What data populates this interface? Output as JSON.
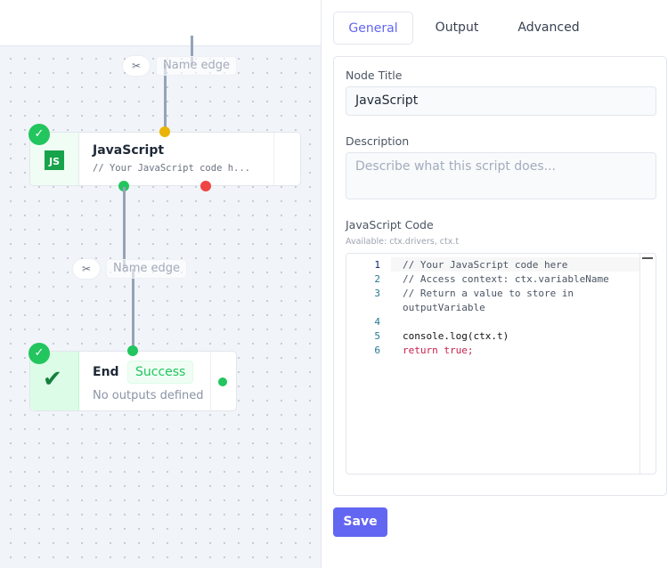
{
  "canvas": {
    "edges": [
      {
        "scissor_icon": "scissors-icon",
        "label": "Name edge"
      },
      {
        "scissor_icon": "scissors-icon",
        "label": "Name edge"
      }
    ],
    "js_node": {
      "title": "JavaScript",
      "subtitle": "// Your JavaScript code h...",
      "icon": "JS",
      "status": "success"
    },
    "end_node": {
      "title": "End",
      "badge": "Success",
      "subtitle": "No outputs defined",
      "status": "success"
    }
  },
  "panel": {
    "tabs": [
      {
        "label": "General",
        "active": true
      },
      {
        "label": "Output"
      },
      {
        "label": "Advanced"
      }
    ],
    "node_title_label": "Node Title",
    "node_title_value": "JavaScript",
    "description_label": "Description",
    "description_placeholder": "Describe what this script does...",
    "code_label": "JavaScript Code",
    "code_hint": "Available: ctx.drivers, ctx.t",
    "code_lines": [
      {
        "n": "1",
        "text": "// Your JavaScript code here"
      },
      {
        "n": "2",
        "text": "// Access context: ctx.variableName"
      },
      {
        "n": "3",
        "text": "// Return a value to store in"
      },
      {
        "n": "",
        "text": "outputVariable"
      },
      {
        "n": "4",
        "text": ""
      },
      {
        "n": "5",
        "text": "console.log(ctx.t)"
      },
      {
        "n": "6",
        "text": "return true;"
      }
    ],
    "save_label": "Save"
  },
  "colors": {
    "accent": "#6366f1",
    "success": "#22c55e",
    "error": "#ef4444",
    "warning": "#eab308"
  }
}
